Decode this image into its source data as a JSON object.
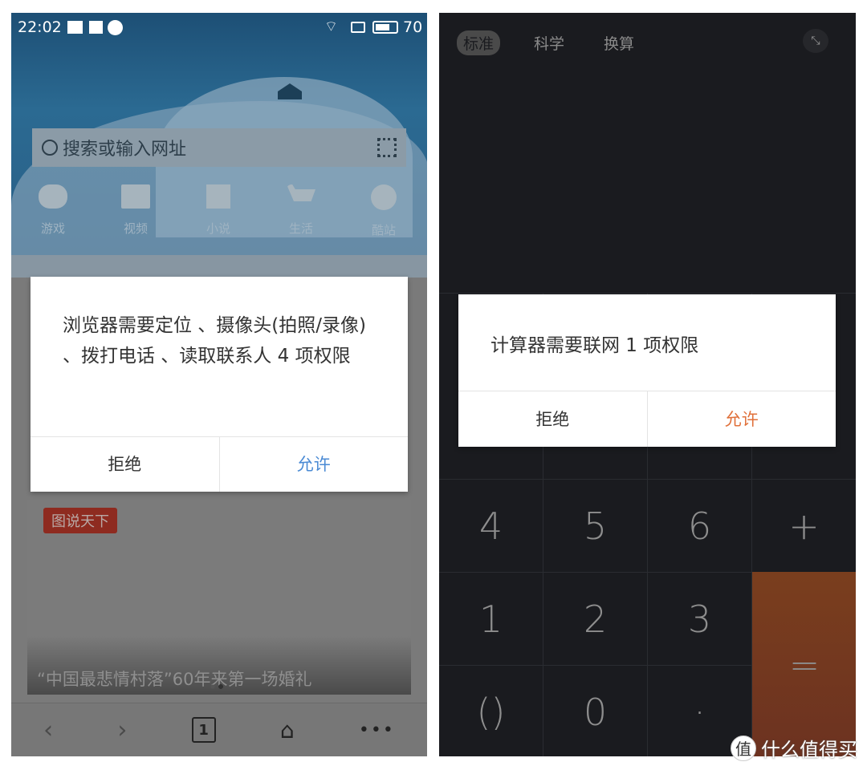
{
  "browser": {
    "status": {
      "time": "22:02",
      "battery": "70",
      "icons": [
        "image-icon",
        "mail-icon",
        "account-icon",
        "wifi-icon",
        "screen-icon",
        "battery-icon"
      ]
    },
    "search": {
      "placeholder": "搜索或输入网址"
    },
    "shortcuts": [
      {
        "label": "游戏",
        "icon": "gamepad-icon"
      },
      {
        "label": "视频",
        "icon": "video-icon"
      },
      {
        "label": "小说",
        "icon": "book-icon"
      },
      {
        "label": "生活",
        "icon": "cart-icon"
      },
      {
        "label": "酷站",
        "icon": "compass-icon"
      }
    ],
    "card": {
      "tag": "图说天下",
      "headline": "“中国最悲情村落”60年来第一场婚礼"
    },
    "nav": {
      "tab_count": "1"
    },
    "dialog": {
      "message": "浏览器需要定位 、摄像头(拍照/录像) 、拨打电话 、读取联系人 4 项权限",
      "deny": "拒绝",
      "allow": "允许",
      "allow_color": "#4a8ad4"
    }
  },
  "calculator": {
    "tabs": [
      "标准",
      "科学",
      "换算"
    ],
    "active_tab": "标准",
    "keys": [
      [
        "4",
        "5",
        "6",
        "+"
      ],
      [
        "1",
        "2",
        "3",
        "="
      ],
      [
        "()",
        "0",
        "·"
      ]
    ],
    "equals_color": "#7a3e1e",
    "dialog": {
      "message": "计算器需要联网 1 项权限",
      "deny": "拒绝",
      "allow": "允许",
      "allow_color": "#e0703a"
    }
  },
  "watermark": {
    "text": "什么值得买",
    "badge": "值"
  }
}
